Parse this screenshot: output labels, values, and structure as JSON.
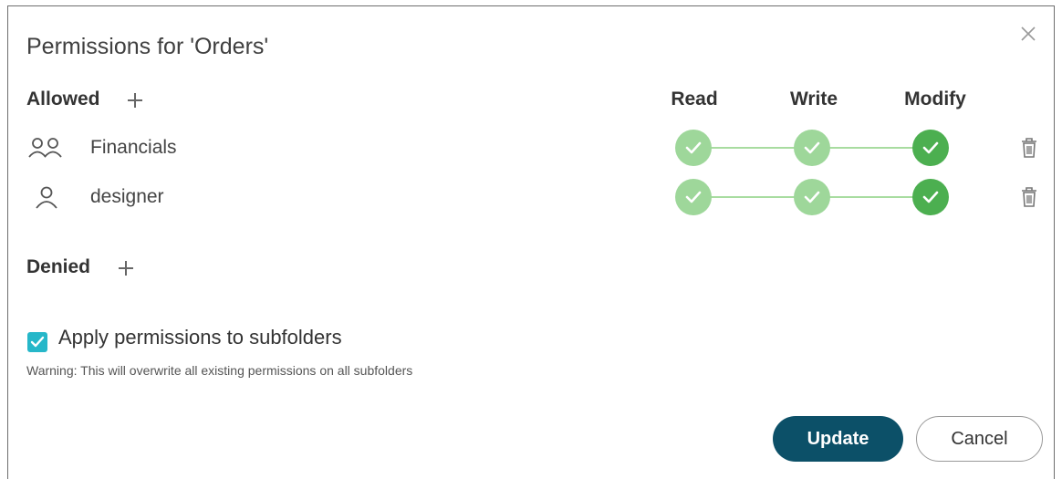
{
  "dialog": {
    "title": "Permissions for 'Orders'"
  },
  "allowed": {
    "label": "Allowed",
    "columns": [
      "Read",
      "Write",
      "Modify"
    ],
    "rows": [
      {
        "type": "group",
        "icon": "group-icon",
        "name": "Financials",
        "read": true,
        "write": true,
        "modify": true
      },
      {
        "type": "user",
        "icon": "user-icon",
        "name": "designer",
        "read": true,
        "write": true,
        "modify": true
      }
    ]
  },
  "denied": {
    "label": "Denied"
  },
  "apply_subfolders": {
    "checked": true,
    "label": "Apply permissions to subfolders",
    "warning": "Warning: This will overwrite all existing permissions on all subfolders"
  },
  "buttons": {
    "update": "Update",
    "cancel": "Cancel"
  },
  "colors": {
    "primary": "#0c5068",
    "check_light": "#9ed79a",
    "check_dark": "#4caf50",
    "checkbox": "#26b7c9"
  }
}
